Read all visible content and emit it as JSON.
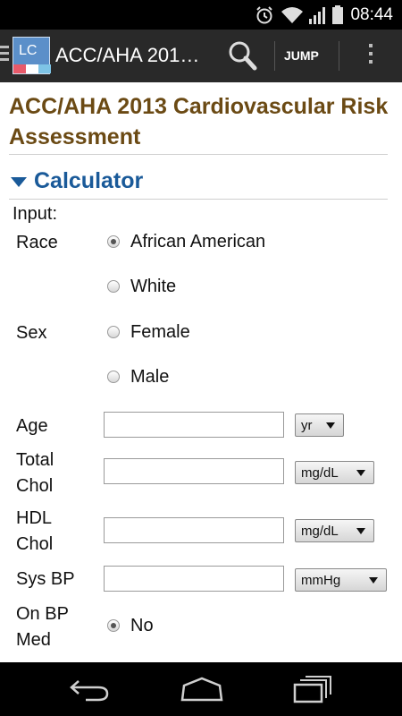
{
  "status": {
    "time": "08:44"
  },
  "appbar": {
    "logo_text": "LC",
    "title": "ACC/AHA 201…",
    "jump_label": "JUMP"
  },
  "page": {
    "title": "ACC/AHA 2013 Cardiovascular Risk Assessment"
  },
  "calculator": {
    "section_label": "Calculator",
    "input_label": "Input:",
    "race": {
      "label": "Race",
      "options": [
        "African American",
        "White"
      ],
      "selected": "African American"
    },
    "sex": {
      "label": "Sex",
      "options": [
        "Female",
        "Male"
      ]
    },
    "age": {
      "label": "Age",
      "value": "",
      "unit": "yr"
    },
    "total_chol": {
      "label_line1": "Total",
      "label_line2": "Chol",
      "value": "",
      "unit": "mg/dL"
    },
    "hdl_chol": {
      "label_line1": "HDL",
      "label_line2": "Chol",
      "value": "",
      "unit": "mg/dL"
    },
    "sys_bp": {
      "label": "Sys BP",
      "value": "",
      "unit": "mmHg"
    },
    "bp_med": {
      "label_line1": "On BP",
      "label_line2": "Med",
      "option": "No",
      "selected": "No"
    }
  },
  "icons": {
    "alarm": "alarm-clock-icon",
    "wifi": "wifi-icon",
    "signal": "cell-signal-icon",
    "battery": "battery-icon",
    "search": "search-icon",
    "overflow": "overflow-menu-icon",
    "back": "back-icon",
    "home": "home-icon",
    "recents": "recent-apps-icon"
  },
  "colors": {
    "title_brown": "#6b4a14",
    "section_blue": "#1a5a99",
    "actionbar": "#292929"
  }
}
